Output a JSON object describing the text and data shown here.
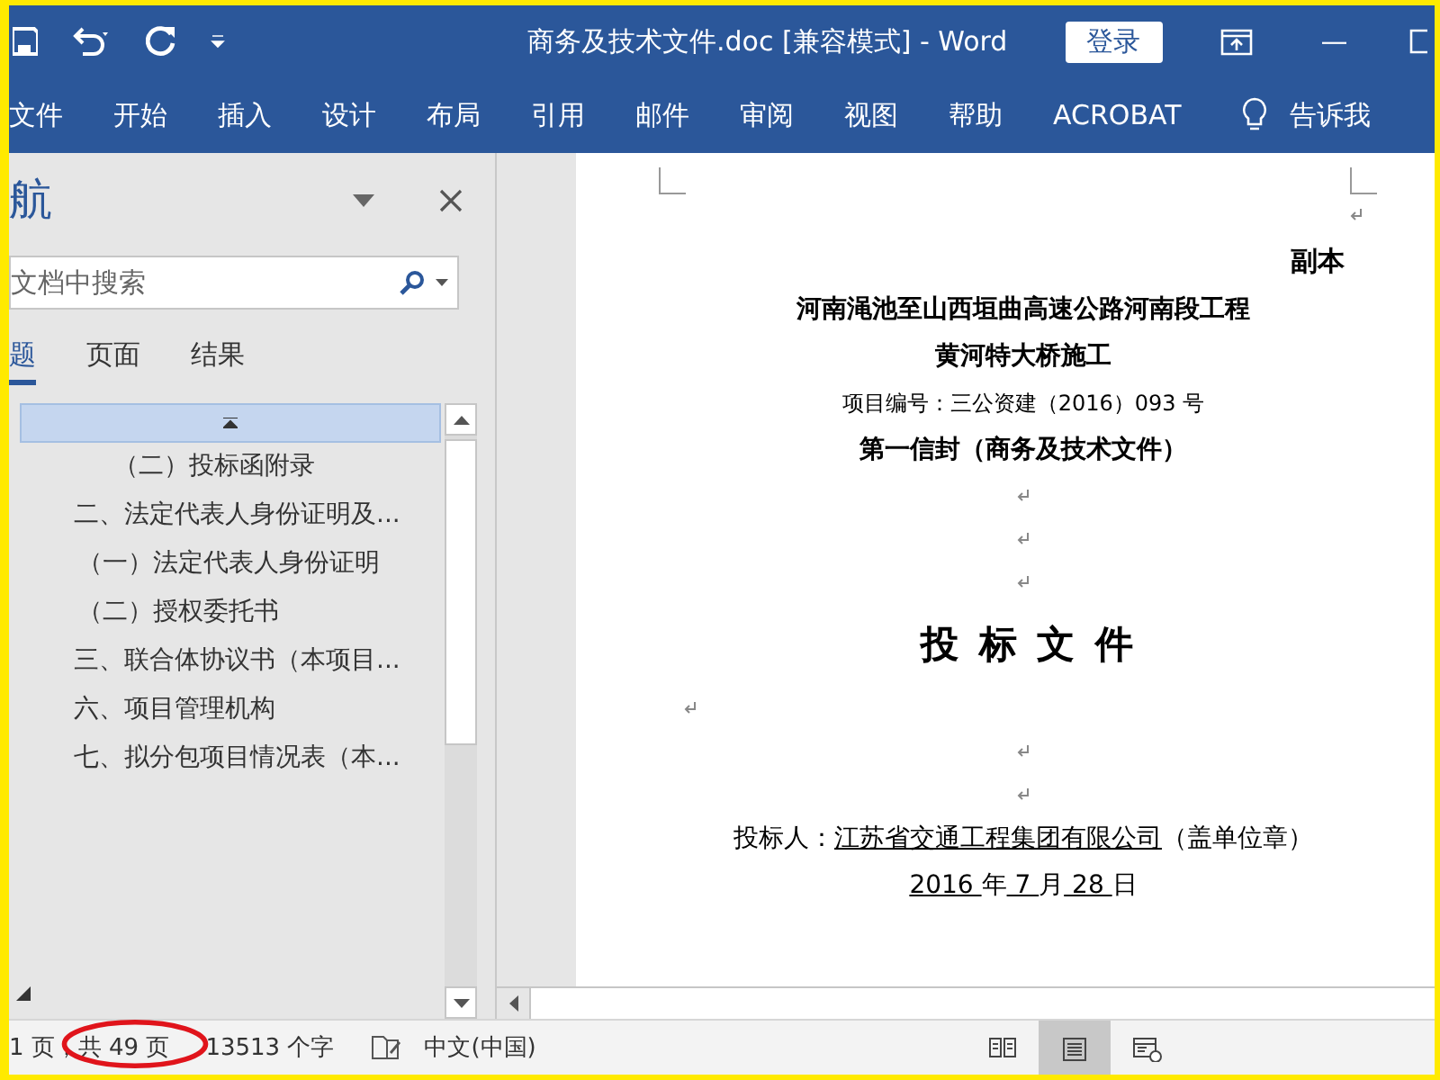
{
  "title_bar": {
    "title": "商务及技术文件.doc [兼容模式]  -  Word",
    "sign_in": "登录",
    "minimize": "—"
  },
  "ribbon": {
    "tabs": [
      "文件",
      "开始",
      "插入",
      "设计",
      "布局",
      "引用",
      "邮件",
      "审阅",
      "视图",
      "帮助",
      "ACROBAT"
    ],
    "tell_me": "告诉我"
  },
  "nav_pane": {
    "title": "航",
    "search": {
      "placeholder": "文档中搜索"
    },
    "tabs": [
      {
        "label": "题",
        "selected": true
      },
      {
        "label": "页面",
        "selected": false
      },
      {
        "label": "结果",
        "selected": false
      }
    ],
    "continued_children": [
      {
        "label": "（二）投标函附录"
      }
    ],
    "items": [
      {
        "label": "二、法定代表人身份证明及...",
        "children": [
          {
            "label": "（一）法定代表人身份证明"
          },
          {
            "label": "（二）授权委托书"
          }
        ]
      },
      {
        "label": "三、联合体协议书（本项目..."
      },
      {
        "label": "六、项目管理机构"
      },
      {
        "label": "七、拟分包项目情况表（本..."
      }
    ]
  },
  "document": {
    "paragraphs": [
      {
        "kind": "mark_right"
      },
      {
        "kind": "copy",
        "parts": [
          {
            "text": "副本",
            "underline": false
          }
        ]
      },
      {
        "kind": "heading",
        "parts": [
          {
            "text": "河南渑池至山西垣曲高速公路河南段工程",
            "underline": false
          }
        ]
      },
      {
        "kind": "heading",
        "parts": [
          {
            "text": "黄河特大桥施工",
            "underline": false
          }
        ]
      },
      {
        "kind": "meta",
        "parts": [
          {
            "text": "项目编号：三公资建（2016）093 号",
            "underline": false
          }
        ]
      },
      {
        "kind": "heading",
        "parts": [
          {
            "text": "第一信封（商务及技术文件）",
            "underline": false
          }
        ]
      },
      {
        "kind": "mark_center"
      },
      {
        "kind": "mark_center"
      },
      {
        "kind": "mark_center"
      },
      {
        "kind": "title",
        "parts": [
          {
            "text": "投 标 文 件",
            "underline": false
          }
        ]
      },
      {
        "kind": "mark_left"
      },
      {
        "kind": "mark_center"
      },
      {
        "kind": "mark_center"
      },
      {
        "kind": "body",
        "parts": [
          {
            "text": "投标人：",
            "underline": false
          },
          {
            "text": "江苏省交通工程集团有限公司",
            "underline": true
          },
          {
            "text": "（盖单位章）",
            "underline": false
          }
        ]
      },
      {
        "kind": "body",
        "parts": [
          {
            "text": "2016 ",
            "underline": true
          },
          {
            "text": "年",
            "underline": false
          },
          {
            "text": "  7  ",
            "underline": true
          },
          {
            "text": "月",
            "underline": false
          },
          {
            "text": " 28 ",
            "underline": true
          },
          {
            "text": "日",
            "underline": false
          }
        ]
      }
    ]
  },
  "status_bar": {
    "page": "1 页，共 49 页",
    "words": "13513 个字",
    "language": "中文(中国)",
    "views": [
      {
        "kind": "read",
        "selected": false
      },
      {
        "kind": "print",
        "selected": true
      },
      {
        "kind": "web",
        "selected": false
      }
    ]
  }
}
